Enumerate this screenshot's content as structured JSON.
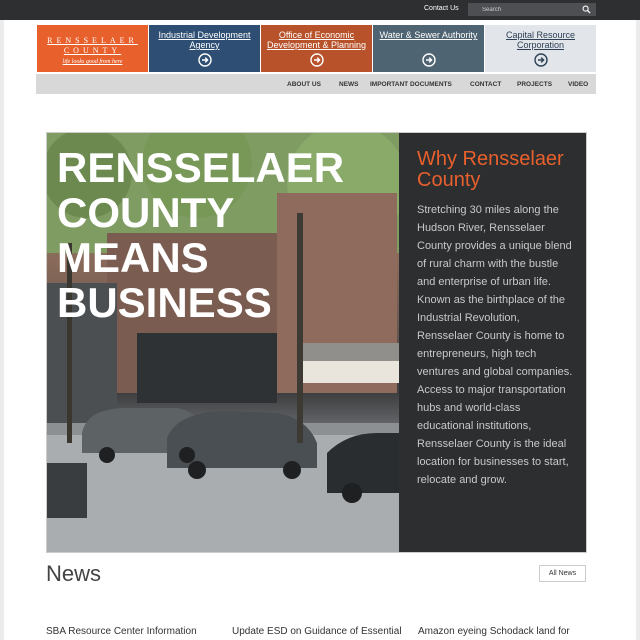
{
  "topbar": {
    "contact_label": "Contact Us",
    "search_placeholder": "Search",
    "search_icon": "search-icon"
  },
  "logo": {
    "line1": "RENSSELAER",
    "line2": "COUNTY",
    "tagline": "life looks good from here",
    "color": "#e8602c"
  },
  "tiles": [
    {
      "label": "Industrial Development Agency",
      "icon": "arrow-circle-right-icon",
      "color": "#2e4f73"
    },
    {
      "label": "Office of Economic Development & Planning",
      "icon": "arrow-circle-right-icon",
      "color": "#b8522a"
    },
    {
      "label": "Water & Sewer Authority",
      "icon": "arrow-circle-right-icon",
      "color": "#4f6472"
    },
    {
      "label": "Capital Resource Corporation",
      "icon": "arrow-circle-right-icon",
      "color": "#e2e6ea"
    }
  ],
  "nav": {
    "items": [
      "ABOUT US",
      "NEWS",
      "IMPORTANT DOCUMENTS",
      "CONTACT",
      "PROJECTS",
      "VIDEO"
    ]
  },
  "hero": {
    "headline": [
      "RENSSELAER",
      "COUNTY",
      "MEANS",
      "BUSINESS"
    ],
    "panel_title": "Why Rensselaer County",
    "panel_body": "Stretching 30 miles along the Hudson River, Rensselaer County provides a unique blend of rural charm with the bustle and enterprise of urban life.  Known as the birthplace of the Industrial Revolution, Rensselaer County is home to entrepreneurs, high tech ventures and global companies.  Access to major transportation hubs and world-class educational institutions, Rensselaer County is the ideal location for businesses to start, relocate and grow.",
    "accent_color": "#e8602c"
  },
  "news": {
    "heading": "News",
    "all_label": "All News",
    "items": [
      "SBA Resource Center Information",
      "Update ESD on Guidance of Essential",
      "Amazon eyeing Schodack land for"
    ]
  }
}
